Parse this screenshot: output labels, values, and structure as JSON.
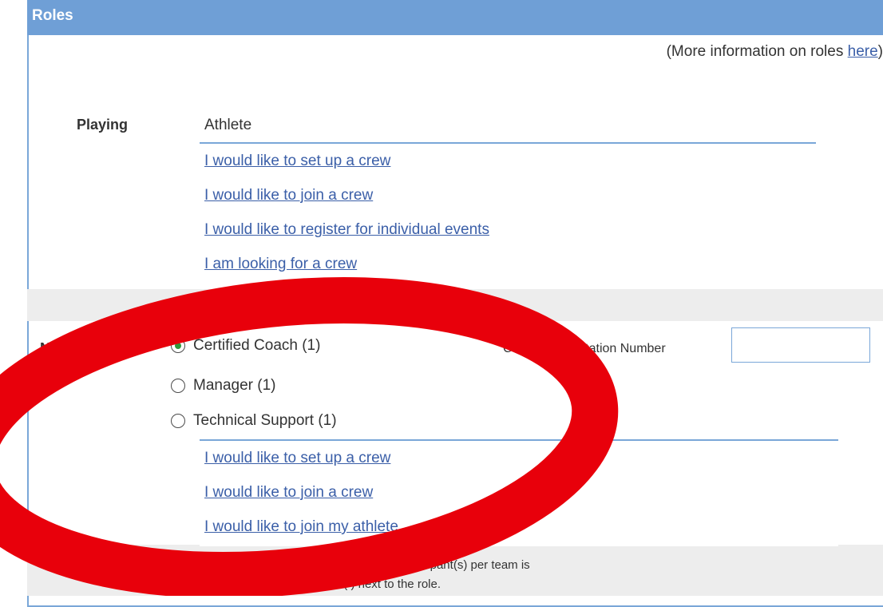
{
  "header": {
    "title": "Roles"
  },
  "more_info": {
    "prefix": "(More information on roles ",
    "link": "here",
    "suffix": ")"
  },
  "playing": {
    "label": "Playing",
    "role": "Athlete",
    "links": [
      "I would like to set up a crew",
      "I would like to join a crew",
      "I would like to register for individual events",
      "I am looking for a crew"
    ]
  },
  "nonplaying": {
    "label": "Non-playing",
    "options": [
      {
        "label": "Certified Coach (1)",
        "checked": true
      },
      {
        "label": "Manager (1)",
        "checked": false
      },
      {
        "label": "Technical Support (1)",
        "checked": false
      }
    ],
    "coach_field_label": "Coach Accreditation Number",
    "coach_field_value": "",
    "links": [
      "I would like to set up a crew",
      "I would like to join a crew",
      "I would like to join my athlete"
    ],
    "note_line1": "The maximum number of non-playing participant(s) per team is",
    "note_line2": "represented by the number ( ) next to the role."
  },
  "colors": {
    "header": "#6f9fd6",
    "link": "#3b5fa8",
    "annotation": "#e8000b",
    "radio_checked": "#2e9a3c"
  },
  "overlay": {
    "shape": "red-ellipse-annotation"
  }
}
